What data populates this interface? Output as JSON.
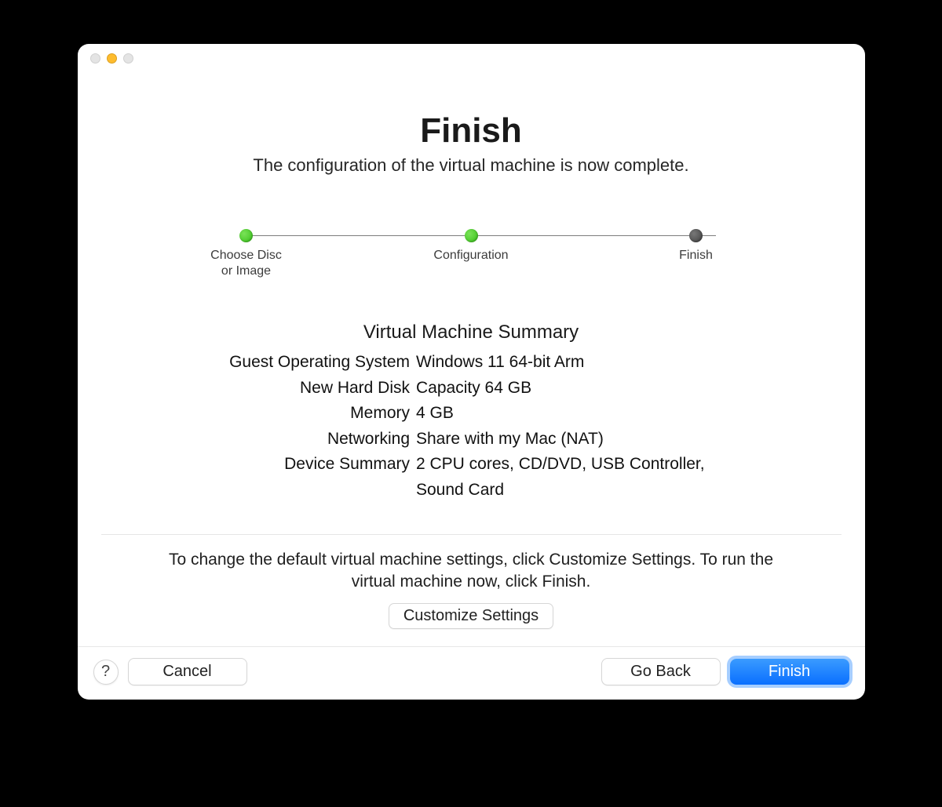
{
  "header": {
    "title": "Finish",
    "subtitle": "The configuration of the virtual machine is now complete."
  },
  "steps": [
    {
      "label": "Choose Disc\nor Image",
      "state": "done"
    },
    {
      "label": "Configuration",
      "state": "done"
    },
    {
      "label": "Finish",
      "state": "current"
    }
  ],
  "summary": {
    "title": "Virtual Machine Summary",
    "rows": [
      {
        "label": "Guest Operating System",
        "value": "Windows 11 64-bit Arm"
      },
      {
        "label": "New Hard Disk",
        "value": "Capacity 64 GB"
      },
      {
        "label": "Memory",
        "value": "4 GB"
      },
      {
        "label": "Networking",
        "value": "Share with my Mac (NAT)"
      },
      {
        "label": "Device Summary",
        "value": "2 CPU cores, CD/DVD, USB Controller, Sound Card"
      }
    ]
  },
  "hint": {
    "text": "To change the default virtual machine settings, click Customize Settings. To run the virtual machine now, click Finish.",
    "customize_label": "Customize Settings"
  },
  "footer": {
    "help_symbol": "?",
    "cancel_label": "Cancel",
    "goback_label": "Go Back",
    "finish_label": "Finish"
  }
}
